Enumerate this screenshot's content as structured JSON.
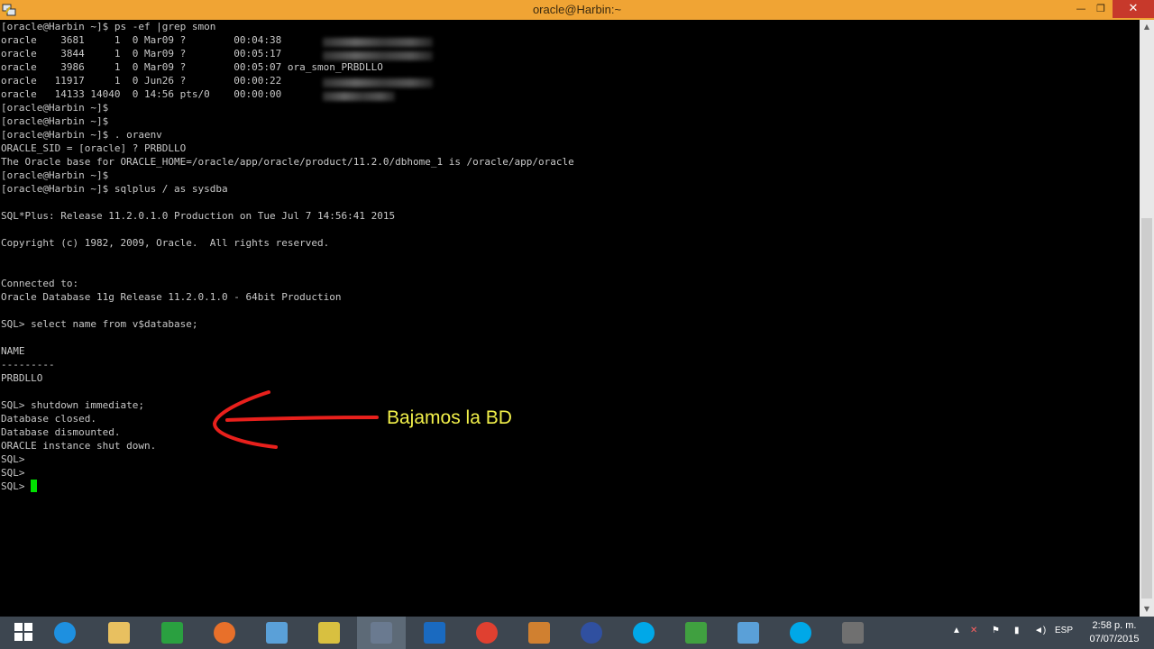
{
  "window": {
    "title": "oracle@Harbin:~",
    "minimize_glyph": "—",
    "maximize_glyph": "❐",
    "close_glyph": "✕"
  },
  "terminal": {
    "lines": [
      "[oracle@Harbin ~]$ ps -ef |grep smon",
      "oracle    3681     1  0 Mar09 ?        00:04:38",
      "oracle    3844     1  0 Mar09 ?        00:05:17",
      "oracle    3986     1  0 Mar09 ?        00:05:07 ora_smon_PRBDLLO",
      "oracle   11917     1  0 Jun26 ?        00:00:22",
      "oracle   14133 14040  0 14:56 pts/0    00:00:00",
      "[oracle@Harbin ~]$",
      "[oracle@Harbin ~]$",
      "[oracle@Harbin ~]$ . oraenv",
      "ORACLE_SID = [oracle] ? PRBDLLO",
      "The Oracle base for ORACLE_HOME=/oracle/app/oracle/product/11.2.0/dbhome_1 is /oracle/app/oracle",
      "[oracle@Harbin ~]$",
      "[oracle@Harbin ~]$ sqlplus / as sysdba",
      "",
      "SQL*Plus: Release 11.2.0.1.0 Production on Tue Jul 7 14:56:41 2015",
      "",
      "Copyright (c) 1982, 2009, Oracle.  All rights reserved.",
      "",
      "",
      "Connected to:",
      "Oracle Database 11g Release 11.2.0.1.0 - 64bit Production",
      "",
      "SQL> select name from v$database;",
      "",
      "NAME",
      "---------",
      "PRBDLLO",
      "",
      "SQL> shutdown immediate;",
      "Database closed.",
      "Database dismounted.",
      "ORACLE instance shut down.",
      "SQL>",
      "SQL>",
      "SQL> "
    ]
  },
  "annotation": {
    "text": "Bajamos la BD",
    "arrow_color": "#e8201c",
    "text_color": "#f2f04a"
  },
  "colors": {
    "titlebar": "#f0a434",
    "terminal_bg": "#000000",
    "terminal_fg": "#c8c8c8",
    "cursor": "#00e000",
    "taskbar": "#3d4650"
  },
  "taskbar": {
    "apps": [
      {
        "name": "start-button",
        "icon": "windows-logo-icon",
        "color": "#ffffff"
      },
      {
        "name": "internet-explorer",
        "icon": "internet-explorer-icon",
        "color": "#1e90e0"
      },
      {
        "name": "file-explorer",
        "icon": "folder-icon",
        "color": "#e8c060"
      },
      {
        "name": "store",
        "icon": "store-icon",
        "color": "#2aa040"
      },
      {
        "name": "firefox",
        "icon": "firefox-icon",
        "color": "#e8702a"
      },
      {
        "name": "remote-desktop-1",
        "icon": "remote-desktop-icon",
        "color": "#5aa0d8"
      },
      {
        "name": "vpn-lock",
        "icon": "padlock-icon",
        "color": "#d8c040"
      },
      {
        "name": "putty",
        "icon": "putty-icon",
        "color": "#6a7a90",
        "active": true
      },
      {
        "name": "outlook",
        "icon": "outlook-icon",
        "color": "#1a6ac0"
      },
      {
        "name": "chrome",
        "icon": "chrome-icon",
        "color": "#e04030"
      },
      {
        "name": "sublime",
        "icon": "sublime-icon",
        "color": "#d08030"
      },
      {
        "name": "keepass",
        "icon": "keepass-icon",
        "color": "#3050a0"
      },
      {
        "name": "skype-1",
        "icon": "skype-icon",
        "color": "#00a8e8"
      },
      {
        "name": "excel-chart",
        "icon": "spreadsheet-chart-icon",
        "color": "#40a040"
      },
      {
        "name": "remote-desktop-2",
        "icon": "remote-desktop-icon",
        "color": "#5aa0d8"
      },
      {
        "name": "skype-2",
        "icon": "skype-icon",
        "color": "#00a8e8"
      },
      {
        "name": "recorder",
        "icon": "camera-icon",
        "color": "#707070"
      }
    ],
    "tray": {
      "language": "ESP",
      "time": "2:58 p. m.",
      "date": "07/07/2015"
    }
  }
}
